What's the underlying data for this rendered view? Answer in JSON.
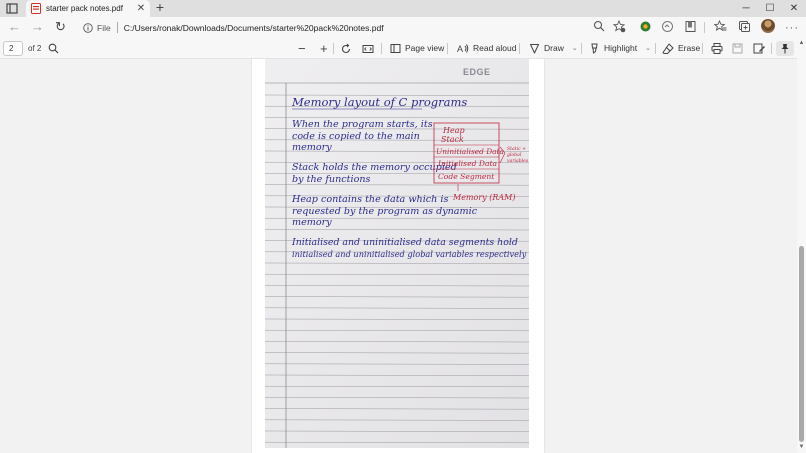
{
  "tab": {
    "title": "starter pack notes.pdf",
    "close_glyph": "✕",
    "icon": "pdf-file-icon"
  },
  "new_tab_glyph": "+",
  "window_controls": {
    "minimize": "─",
    "maximize": "☐",
    "close": "✕"
  },
  "nav": {
    "back": "←",
    "forward": "→",
    "refresh": "↻"
  },
  "address": {
    "scheme_label": "File",
    "url": "C:/Users/ronak/Downloads/Documents/starter%20pack%20notes.pdf"
  },
  "pdf_toolbar": {
    "page_number": "2",
    "page_total": "of 2",
    "zoom_out": "−",
    "zoom_in": "+",
    "page_view_label": "Page view",
    "read_aloud_label": "Read aloud",
    "draw_label": "Draw",
    "highlight_label": "Highlight",
    "erase_label": "Erase"
  },
  "notebook": {
    "brand": "EDGE",
    "heading": "Memory layout of C programs",
    "para1": [
      "When the program starts, its",
      "code is copied to the main",
      "memory"
    ],
    "para2": [
      "Stack holds the memory occupied",
      "by the functions"
    ],
    "para3": [
      "Heap contains the data which is",
      "requested by the program as dynamic",
      "memory"
    ],
    "para4": [
      "Initialised and uninitialised data segments hold",
      "initialised and uninitialised global variables respectively"
    ],
    "diagram": {
      "segments": [
        "Heap",
        "Stack",
        "Uninitialised Data",
        "Initialised Data",
        "Code Segment"
      ],
      "side_note": [
        "Static +",
        "global",
        "variables"
      ],
      "caption": "Memory (RAM)"
    }
  }
}
